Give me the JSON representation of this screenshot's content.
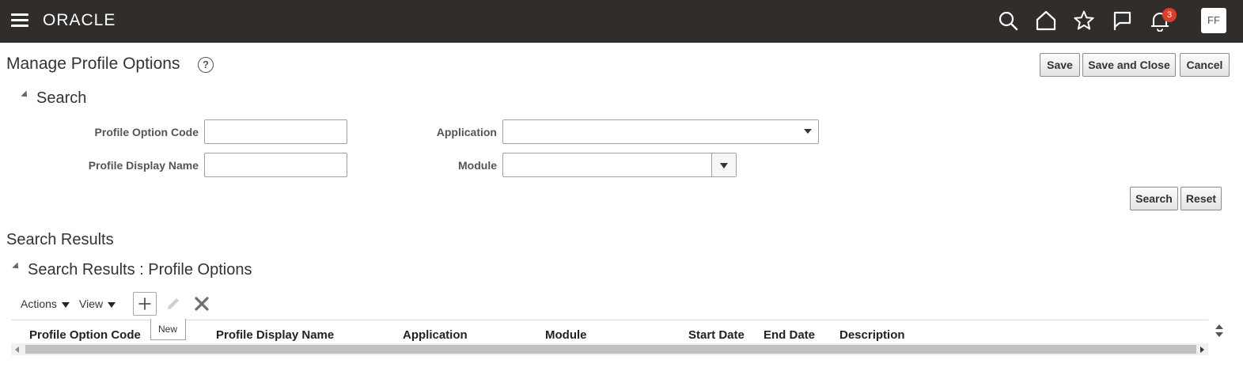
{
  "topbar": {
    "logo": "ORACLE",
    "notification_count": "3",
    "avatar_initials": "FF",
    "bg_color": "#312d2a",
    "icons": [
      "menu-icon",
      "search-icon",
      "home-icon",
      "star-icon",
      "flag-icon",
      "bell-icon"
    ]
  },
  "header": {
    "title": "Manage Profile Options",
    "help": "?",
    "save_label": "Save",
    "save_close_label": "Save and Close",
    "cancel_label": "Cancel"
  },
  "search": {
    "title": "Search",
    "profile_option_code_label": "Profile Option Code",
    "profile_option_code_value": "",
    "profile_display_name_label": "Profile Display Name",
    "profile_display_name_value": "",
    "application_label": "Application",
    "application_value": "",
    "module_label": "Module",
    "module_value": "",
    "search_button": "Search",
    "reset_button": "Reset"
  },
  "results": {
    "heading": "Search Results",
    "subheading": "Search Results : Profile Options",
    "actions_label": "Actions",
    "view_label": "View",
    "new_tooltip": "New",
    "columns": [
      "Profile Option Code",
      "Profile Display Name",
      "Application",
      "Module",
      "Start Date",
      "End Date",
      "Description"
    ]
  }
}
